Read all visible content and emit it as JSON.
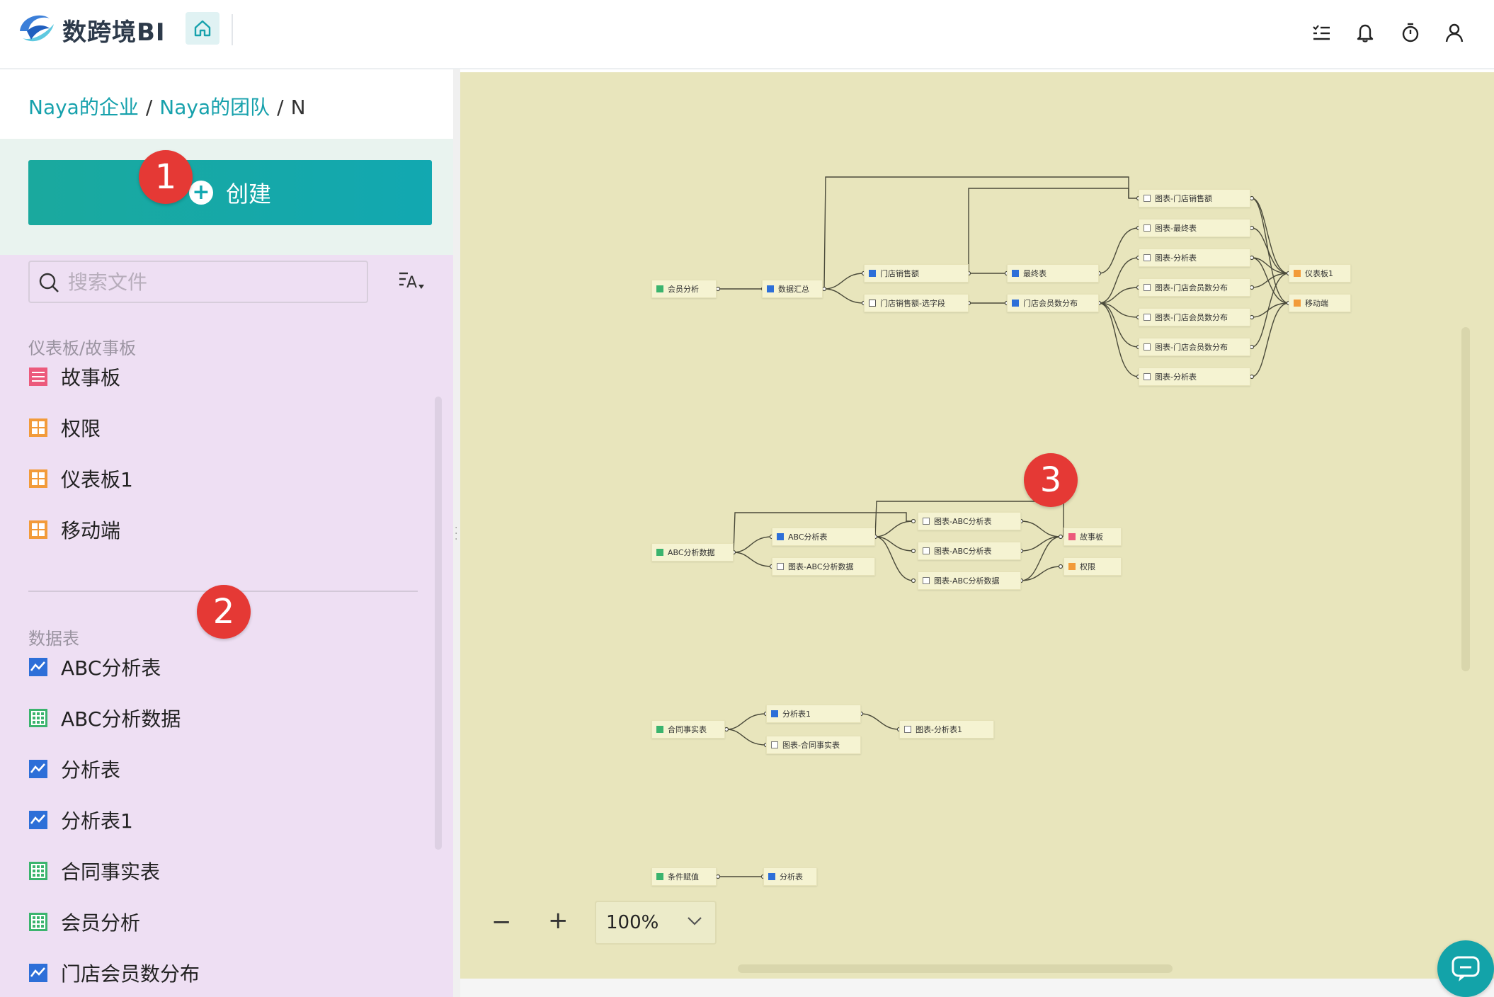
{
  "app": {
    "brand": "数跨境BI"
  },
  "header": {
    "icons": [
      "home-icon",
      "task-list-icon",
      "bell-icon",
      "timer-icon",
      "user-icon"
    ]
  },
  "breadcrumb": {
    "org": "Naya的企业",
    "team": "Naya的团队",
    "current": "N",
    "sep": "/"
  },
  "create": {
    "label": "创建"
  },
  "search": {
    "placeholder": "搜索文件"
  },
  "sections": {
    "dashboards": {
      "title": "仪表板/故事板",
      "items": [
        {
          "label": "故事板",
          "icon": "storyboard-icon",
          "color": "#ec5a7c"
        },
        {
          "label": "权限",
          "icon": "dashboard-icon",
          "color": "#f29b3a"
        },
        {
          "label": "仪表板1",
          "icon": "dashboard-icon",
          "color": "#f29b3a"
        },
        {
          "label": "移动端",
          "icon": "dashboard-icon",
          "color": "#f29b3a"
        }
      ]
    },
    "tables": {
      "title": "数据表",
      "items": [
        {
          "label": "ABC分析表",
          "icon": "analysis-table-icon",
          "color": "#2d6fd8"
        },
        {
          "label": "ABC分析数据",
          "icon": "data-sheet-icon",
          "color": "#3bb46e"
        },
        {
          "label": "分析表",
          "icon": "analysis-table-icon",
          "color": "#2d6fd8"
        },
        {
          "label": "分析表1",
          "icon": "analysis-table-icon",
          "color": "#2d6fd8"
        },
        {
          "label": "合同事实表",
          "icon": "data-sheet-icon",
          "color": "#3bb46e"
        },
        {
          "label": "会员分析",
          "icon": "data-sheet-icon",
          "color": "#3bb46e"
        },
        {
          "label": "门店会员数分布",
          "icon": "analysis-table-icon",
          "color": "#2d6fd8"
        }
      ]
    }
  },
  "markers": [
    "1",
    "2",
    "3"
  ],
  "lineage": {
    "nodes": {
      "n1": {
        "label": "会员分析",
        "kind": "sheet"
      },
      "n2": {
        "label": "数据汇总",
        "kind": "chart"
      },
      "n3": {
        "label": "门店销售额",
        "kind": "chart"
      },
      "n4": {
        "label": "门店销售额-选字段",
        "kind": "mixed"
      },
      "n5": {
        "label": "最终表",
        "kind": "chart"
      },
      "n6": {
        "label": "门店会员数分布",
        "kind": "chart"
      },
      "n7": {
        "label": "图表-门店销售额",
        "kind": "graph"
      },
      "n8": {
        "label": "图表-最终表",
        "kind": "graph"
      },
      "n9": {
        "label": "图表-分析表",
        "kind": "graph"
      },
      "n10": {
        "label": "图表-门店会员数分布",
        "kind": "graph"
      },
      "n11": {
        "label": "图表-门店会员数分布",
        "kind": "graph"
      },
      "n12": {
        "label": "图表-门店会员数分布",
        "kind": "graph"
      },
      "n13": {
        "label": "图表-分析表",
        "kind": "graph"
      },
      "n14": {
        "label": "仪表板1",
        "kind": "dash"
      },
      "n15": {
        "label": "移动端",
        "kind": "dash"
      },
      "m1": {
        "label": "ABC分析数据",
        "kind": "sheet"
      },
      "m2": {
        "label": "ABC分析表",
        "kind": "chart"
      },
      "m3": {
        "label": "图表-ABC分析数据",
        "kind": "graph"
      },
      "m4": {
        "label": "图表-ABC分析表",
        "kind": "graph"
      },
      "m5": {
        "label": "图表-ABC分析表",
        "kind": "graph"
      },
      "m6": {
        "label": "图表-ABC分析数据",
        "kind": "graph"
      },
      "m7": {
        "label": "故事板",
        "kind": "story"
      },
      "m8": {
        "label": "权限",
        "kind": "dash"
      },
      "c1": {
        "label": "合同事实表",
        "kind": "sheet"
      },
      "c2": {
        "label": "分析表1",
        "kind": "chart"
      },
      "c3": {
        "label": "图表-合同事实表",
        "kind": "graph"
      },
      "c4": {
        "label": "图表-分析表1",
        "kind": "graph"
      },
      "d1": {
        "label": "条件赋值",
        "kind": "sheet"
      },
      "d2": {
        "label": "分析表",
        "kind": "chart"
      }
    }
  },
  "zoom": {
    "minus": "−",
    "plus": "+",
    "level": "100%"
  }
}
